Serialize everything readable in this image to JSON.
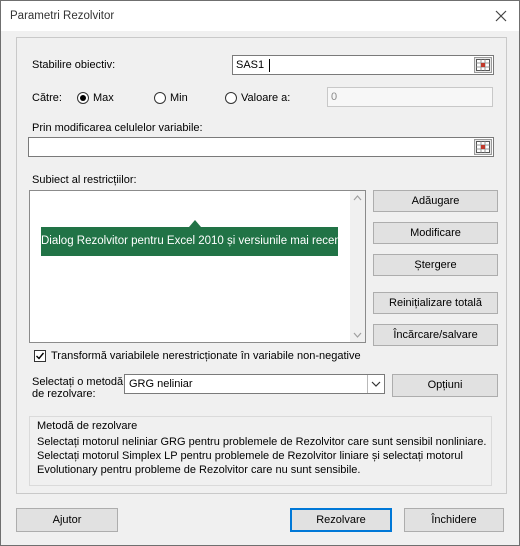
{
  "window": {
    "title": "Parametri Rezolvitor"
  },
  "objective": {
    "label": "Stabilire obiectiv:",
    "value": "SAS1"
  },
  "to": {
    "label": "Către:",
    "options": [
      {
        "label": "Max",
        "selected": true
      },
      {
        "label": "Min",
        "selected": false
      },
      {
        "label": "Valoare a:",
        "selected": false
      }
    ],
    "value_field": "0"
  },
  "changing_cells": {
    "label": "Prin modificarea celulelor variabile:",
    "value": ""
  },
  "constraints": {
    "label": "Subiect al restricțiilor:",
    "buttons": {
      "add": "Adăugare",
      "change": "Modificare",
      "delete": "Ștergere",
      "reset": "Reinițializare totală",
      "load_save": "Încărcare/salvare"
    }
  },
  "tooltip": "Dialog Rezolvitor pentru Excel 2010 și versiunile mai recente",
  "nonnegative": {
    "label": "Transformă variabilele nerestricționate în variabile non-negative",
    "checked": true
  },
  "method": {
    "label_line1": "Selectați o metodă",
    "label_line2": "de rezolvare:",
    "selected": "GRG neliniar",
    "options_button": "Opțiuni"
  },
  "method_info": {
    "title": "Metodă de rezolvare",
    "lines": [
      "Selectați motorul neliniar GRG pentru problemele de Rezolvitor care sunt sensibil nonliniare.",
      "Selectați motorul Simplex LP pentru problemele de Rezolvitor liniare și selectați motorul",
      "Evolutionary pentru probleme de Rezolvitor care nu sunt sensibile."
    ]
  },
  "footer": {
    "help": "Ajutor",
    "solve": "Rezolvare",
    "close": "Închidere"
  },
  "icons": {
    "close": "close-icon",
    "range_selector": "range-selector-icon",
    "checkmark": "checkmark-icon",
    "dropdown": "chevron-down-icon"
  },
  "colors": {
    "tooltip_bg": "#217346",
    "focus_border": "#0078d7"
  }
}
